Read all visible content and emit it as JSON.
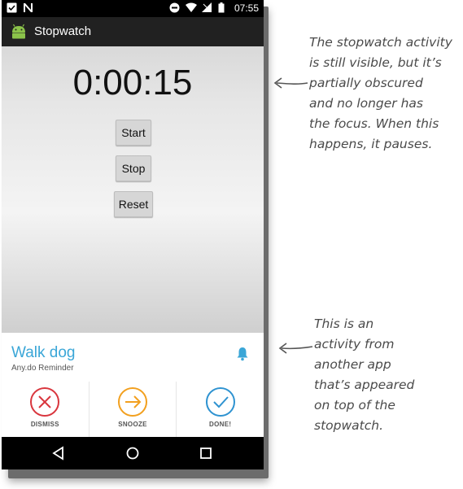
{
  "status_bar": {
    "time": "07:55",
    "left_icons": [
      "checkbox-notification-icon",
      "n-notification-icon"
    ],
    "right_icons": [
      "do-not-disturb-icon",
      "wifi-icon",
      "signal-icon",
      "battery-icon"
    ]
  },
  "action_bar": {
    "title": "Stopwatch",
    "icon": "android-robot-icon"
  },
  "stopwatch": {
    "time": "0:00:15",
    "start_label": "Start",
    "stop_label": "Stop",
    "reset_label": "Reset"
  },
  "reminder": {
    "title": "Walk dog",
    "subtitle": "Any.do Reminder",
    "accent_color": "#3aa6d7",
    "actions": [
      {
        "label": "DISMISS",
        "icon": "x-circle-icon",
        "color": "#d9363e"
      },
      {
        "label": "SNOOZE",
        "icon": "arrow-circle-icon",
        "color": "#f2a01f"
      },
      {
        "label": "DONE!",
        "icon": "check-circle-icon",
        "color": "#2f93d1"
      }
    ]
  },
  "nav_bar": {
    "icons": [
      "back-icon",
      "home-icon",
      "recents-icon"
    ]
  },
  "annotations": {
    "top": "The stopwatch activity\nis still visible, but it’s\npartially obscured\nand no longer has\nthe focus. When this\nhappens, it pauses.",
    "bottom": "This is an\nactivity from\nanother app\nthat’s appeared\non top of the\nstopwatch."
  }
}
